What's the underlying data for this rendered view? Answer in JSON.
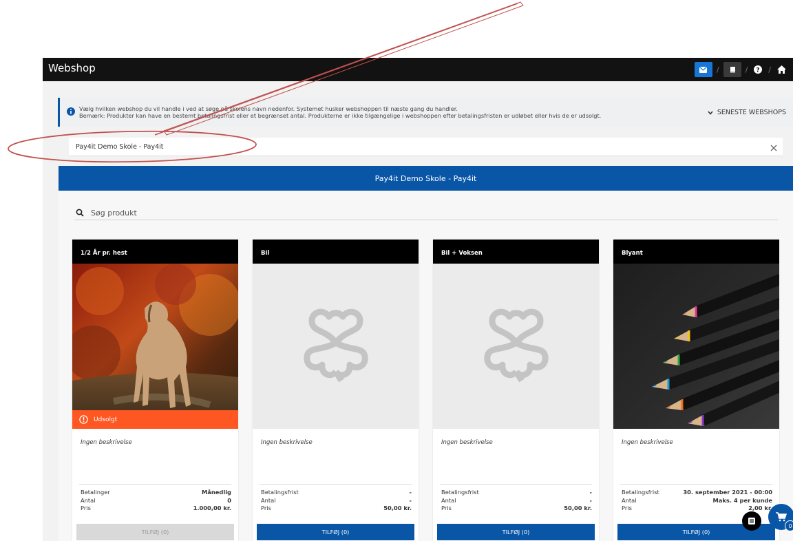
{
  "header": {
    "title": "Webshop",
    "icons": [
      "envelope-icon",
      "book-icon",
      "question-icon",
      "home-icon"
    ],
    "separator": "/"
  },
  "info": {
    "line1": "Vælg hvilken webshop du vil handle i ved at søge på skolens navn nedenfor. Systemet husker webshoppen til næste gang du handler.",
    "line2": "Bemærk: Produkter kan have en bestemt betalingsfrist eller et begrænset antal. Produkterne er ikke tilgængelige i webshoppen efter betalingsfristen er udløbet eller hvis de er udsolgt.",
    "latest_label": "SENESTE WEBSHOPS"
  },
  "shop_select": {
    "value": "Pay4it Demo Skole - Pay4it"
  },
  "shop_banner": {
    "title": "Pay4it Demo Skole - Pay4it"
  },
  "search": {
    "placeholder": "Søg produkt"
  },
  "products": [
    {
      "title": "1/2 År pr. hest",
      "status": "Udsolgt",
      "description": "Ingen beskrivelse",
      "rows": [
        {
          "label": "Betalinger",
          "value": "Månedlig"
        },
        {
          "label": "Antal",
          "value": "0"
        },
        {
          "label": "Pris",
          "value": "1.000,00 kr."
        }
      ],
      "button": "TILFØJ (0)"
    },
    {
      "title": "Bil",
      "description": "Ingen beskrivelse",
      "rows": [
        {
          "label": "Betalingsfrist",
          "value": "-"
        },
        {
          "label": "Antal",
          "value": "-"
        },
        {
          "label": "Pris",
          "value": "50,00 kr."
        }
      ],
      "button": "TILFØJ (0)"
    },
    {
      "title": "Bil + Voksen",
      "description": "Ingen beskrivelse",
      "rows": [
        {
          "label": "Betalingsfrist",
          "value": "-"
        },
        {
          "label": "Antal",
          "value": "-"
        },
        {
          "label": "Pris",
          "value": "50,00 kr."
        }
      ],
      "button": "TILFØJ (0)"
    },
    {
      "title": "Blyant",
      "description": "Ingen beskrivelse",
      "rows": [
        {
          "label": "Betalingsfrist",
          "value": "30. september 2021 - 00:00"
        },
        {
          "label": "Antal",
          "value": "Maks. 4 per kunde"
        },
        {
          "label": "Pris",
          "value": "2,00 kr."
        }
      ],
      "button": "TILFØJ (0)"
    }
  ],
  "cart": {
    "count": "0"
  },
  "colors": {
    "primary": "#0a56a6",
    "soldout": "#ff5722",
    "annotation": "#c0504d"
  }
}
